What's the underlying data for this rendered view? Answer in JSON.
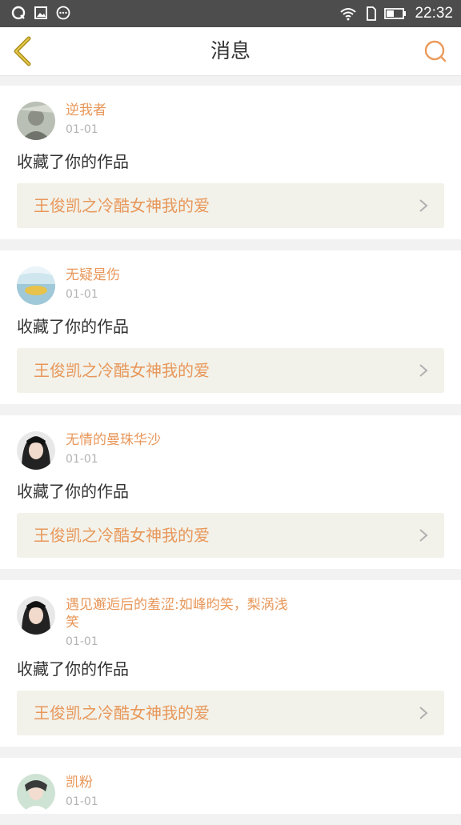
{
  "status_bar": {
    "time": "22:32"
  },
  "header": {
    "title": "消息"
  },
  "colors": {
    "accent": "#e8975a",
    "work_bg": "#f2f2ea"
  },
  "messages": [
    {
      "user": "逆我者",
      "date": "01-01",
      "action": "收藏了你的作品",
      "work_title": "王俊凯之冷酷女神我的爱"
    },
    {
      "user": "无疑是伤",
      "date": "01-01",
      "action": "收藏了你的作品",
      "work_title": "王俊凯之冷酷女神我的爱"
    },
    {
      "user": "无情的曼珠华沙",
      "date": "01-01",
      "action": "收藏了你的作品",
      "work_title": "王俊凯之冷酷女神我的爱"
    },
    {
      "user": "遇见邂逅后的羞涩:如峰昀笑，梨涡浅笑",
      "date": "01-01",
      "action": "收藏了你的作品",
      "work_title": "王俊凯之冷酷女神我的爱"
    },
    {
      "user": "凯粉",
      "date": "01-01",
      "action": "",
      "work_title": ""
    }
  ],
  "icons": [
    "qq-icon",
    "image-icon",
    "chat-icon",
    "wifi-icon",
    "sim-icon",
    "battery-icon",
    "back-arrow-icon",
    "search-icon",
    "chevron-right-icon"
  ]
}
